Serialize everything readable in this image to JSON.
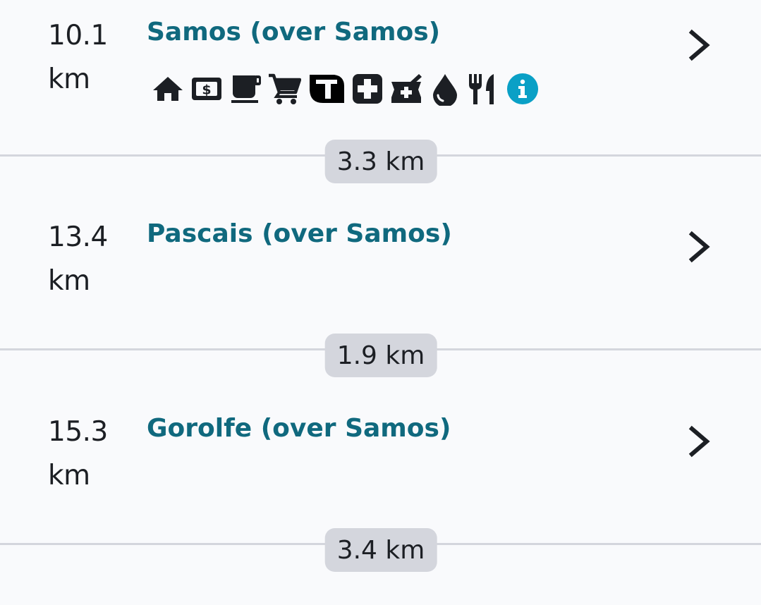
{
  "stages": [
    {
      "distance": "10.1",
      "unit": "km",
      "title": "Samos (over Samos)"
    },
    {
      "distance": "13.4",
      "unit": "km",
      "title": "Pascais (over Samos)"
    },
    {
      "distance": "15.3",
      "unit": "km",
      "title": "Gorolfe (over Samos)"
    }
  ],
  "segments": [
    "3.3 km",
    "1.9 km",
    "3.4 km"
  ],
  "amenity_icons": [
    "home-icon",
    "atm-icon",
    "cafe-icon",
    "shopping-cart-icon",
    "bus-icon",
    "medical-icon",
    "pharmacy-icon",
    "water-icon",
    "restaurant-icon",
    "info-icon"
  ],
  "colors": {
    "title": "#10697e",
    "info": "#0aa0c6",
    "pill": "#d4d6dd",
    "background": "#f9fafc"
  }
}
